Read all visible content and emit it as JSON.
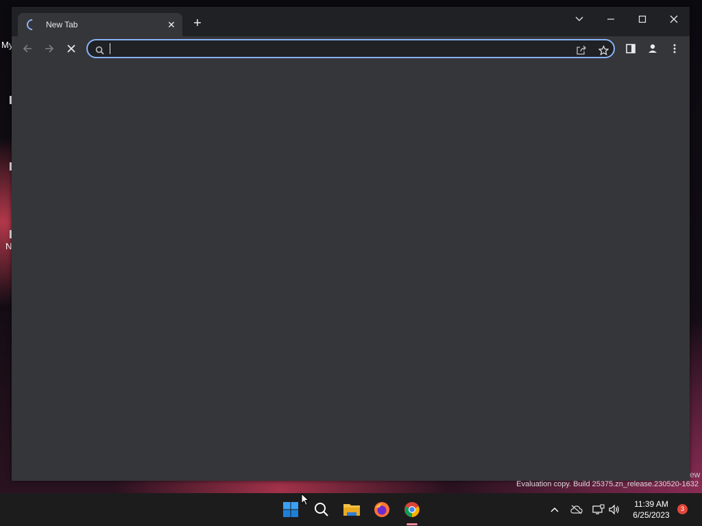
{
  "desktop": {
    "icon_label_1": "My",
    "icon_label_2": "N",
    "icon_label_3": "ew",
    "watermark": "Evaluation copy. Build 25375.zn_release.230520-1632"
  },
  "browser": {
    "tab": {
      "title": "New Tab",
      "icon": "loading-spinner-icon"
    },
    "new_tab_label": "+",
    "address_bar": {
      "value": "",
      "placeholder": ""
    },
    "colors": {
      "frame": "#202124",
      "toolbar": "#35363a",
      "focus_ring": "#8ab4f8"
    }
  },
  "taskbar": {
    "apps": [
      "windows-start-icon",
      "search-icon",
      "file-explorer-icon",
      "firefox-icon",
      "chrome-icon"
    ],
    "clock_time": "11:39 AM",
    "clock_date": "6/25/2023",
    "notification_count": "3"
  }
}
